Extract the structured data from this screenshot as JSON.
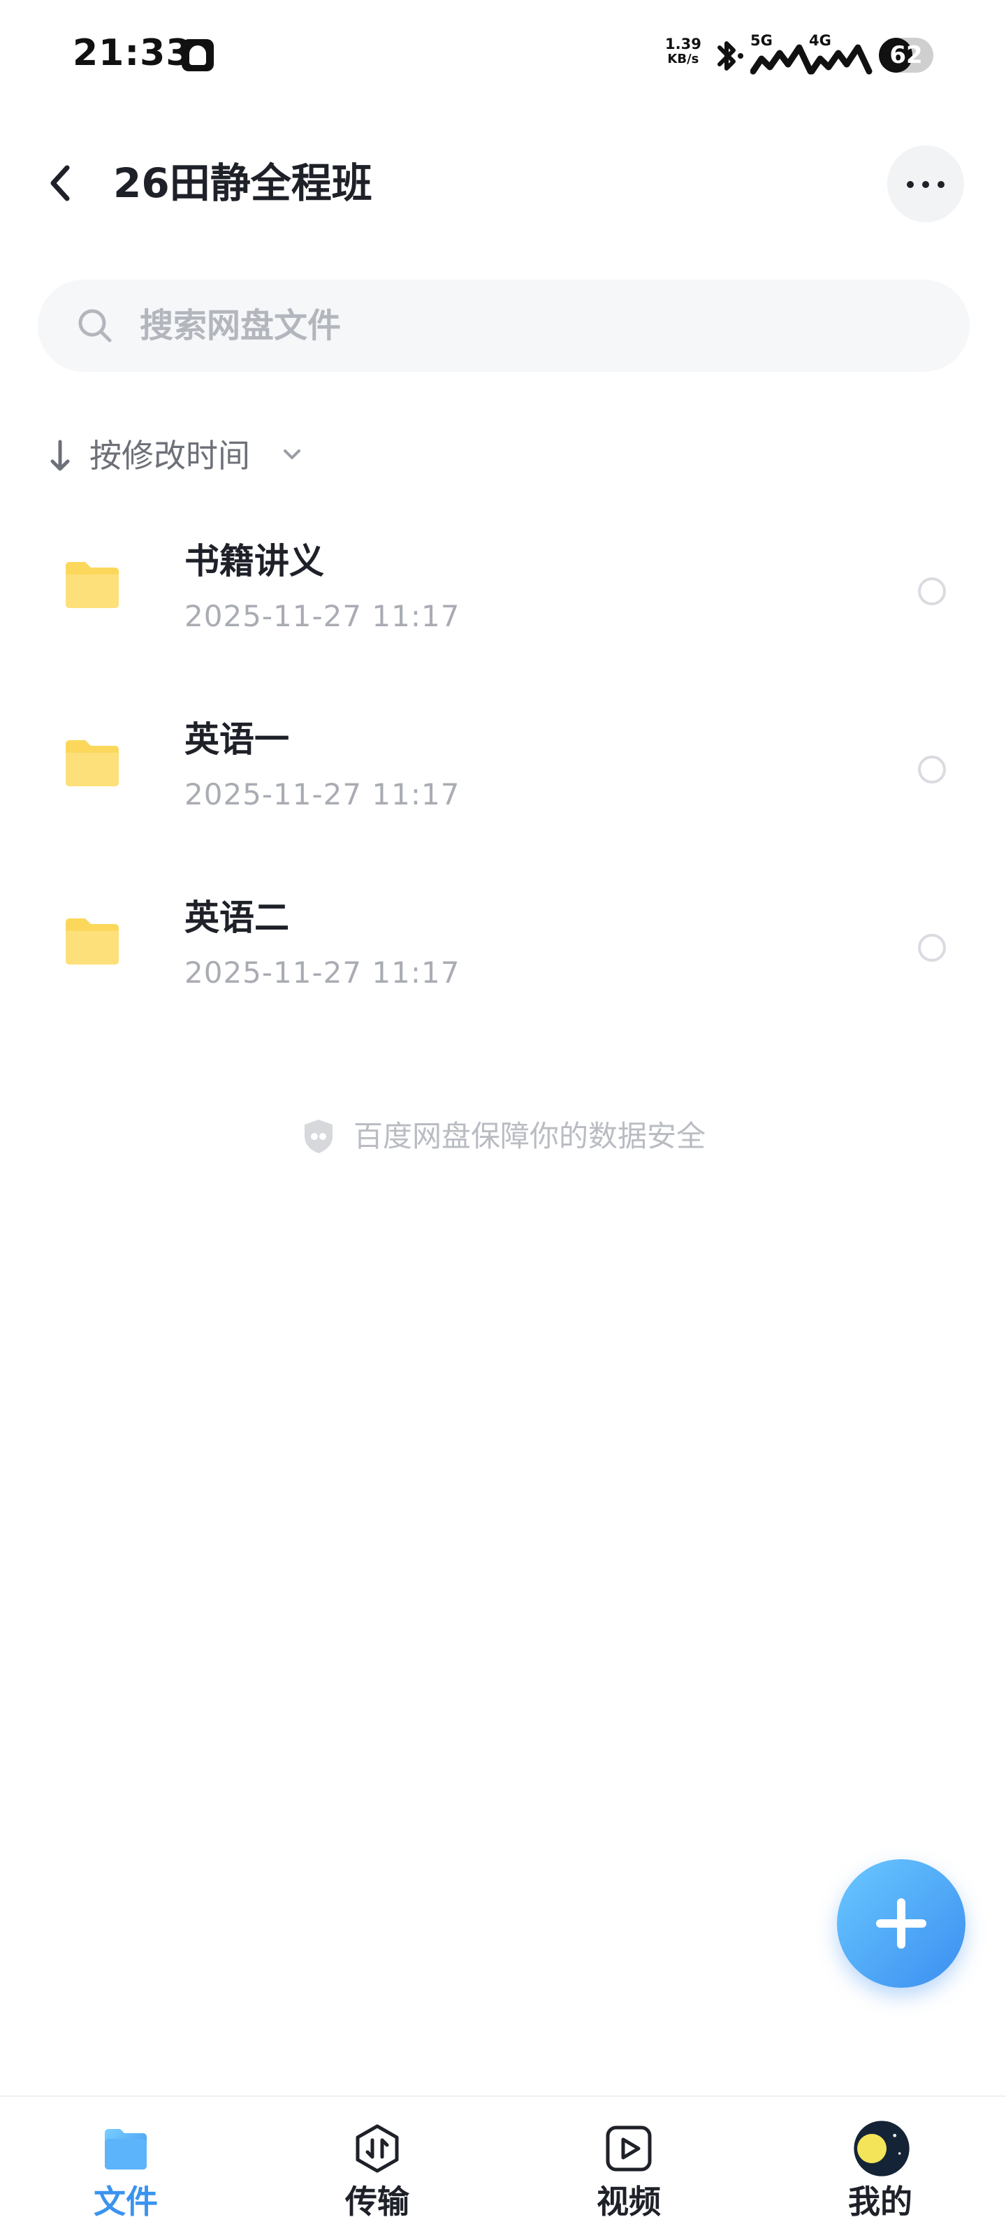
{
  "status_bar": {
    "time": "21:33",
    "net_speed_value": "1.39",
    "net_speed_unit": "KB/s",
    "signal_1_label": "5G",
    "signal_2_label": "4G",
    "battery_level": "62",
    "battery_fraction": 0.62,
    "icons": [
      "app-notification-icon",
      "bluetooth-icon",
      "signal-5g-icon",
      "signal-4g-icon",
      "battery-icon"
    ]
  },
  "header": {
    "title": "26田静全程班"
  },
  "search": {
    "placeholder": "搜索网盘文件"
  },
  "sort": {
    "label": "按修改时间"
  },
  "files": [
    {
      "name": "书籍讲义",
      "date": "2025-11-27  11:17",
      "type": "folder"
    },
    {
      "name": "英语一",
      "date": "2025-11-27  11:17",
      "type": "folder"
    },
    {
      "name": "英语二",
      "date": "2025-11-27  11:17",
      "type": "folder"
    }
  ],
  "security_note": "百度网盘保障你的数据安全",
  "bottom_nav": {
    "items": [
      {
        "label": "文件",
        "active": true,
        "icon": "files-icon"
      },
      {
        "label": "传输",
        "active": false,
        "icon": "transfer-icon"
      },
      {
        "label": "视频",
        "active": false,
        "icon": "video-icon"
      },
      {
        "label": "我的",
        "active": false,
        "icon": "avatar-icon"
      }
    ]
  },
  "colors": {
    "accent": "#3a93ef",
    "folder": "#fbd85c",
    "secondary_text": "#a9acb3"
  }
}
